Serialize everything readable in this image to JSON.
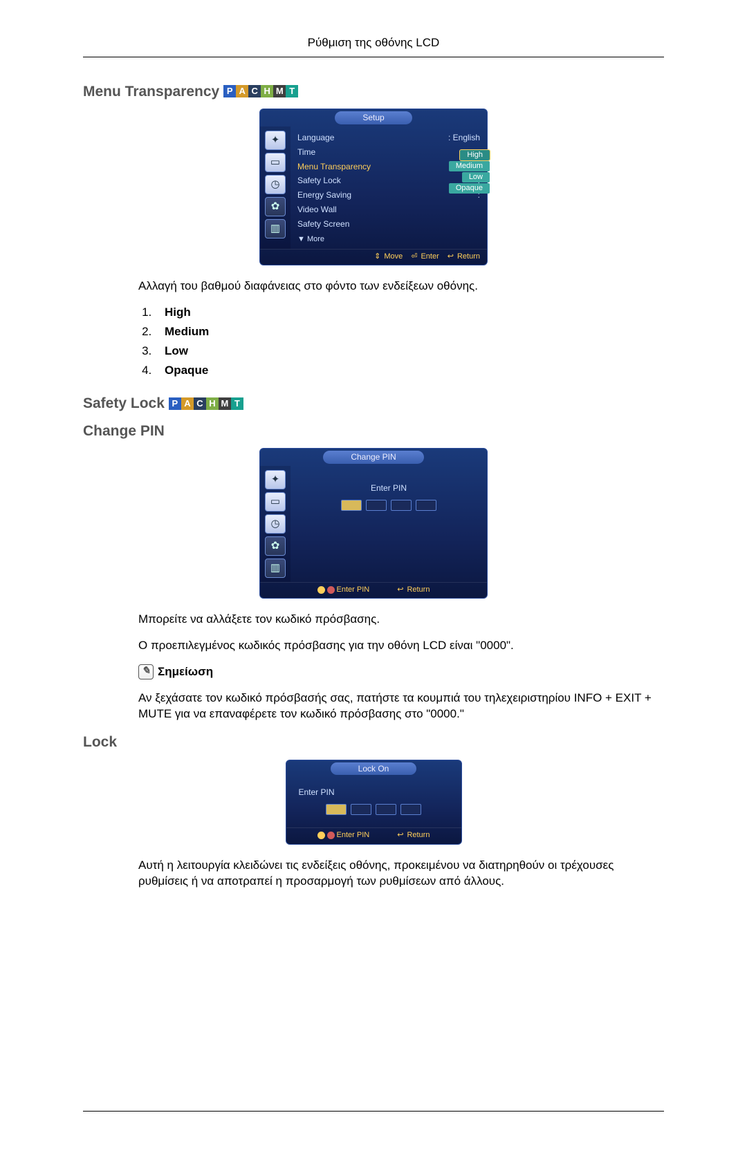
{
  "header": {
    "title": "Ρύθμιση της οθόνης LCD"
  },
  "badges": {
    "p": "P",
    "a": "A",
    "c": "C",
    "h": "H",
    "m": "M",
    "t": "T"
  },
  "section1": {
    "title": "Menu Transparency",
    "osd": {
      "title": "Setup",
      "rows": [
        {
          "k": "Language",
          "v": ": English"
        },
        {
          "k": "Time",
          "v": ""
        },
        {
          "k": "Menu Transparency",
          "v": ":",
          "selected": true
        },
        {
          "k": "Safety Lock",
          "v": ":"
        },
        {
          "k": "Energy Saving",
          "v": ":"
        },
        {
          "k": "Video Wall",
          "v": ""
        },
        {
          "k": "Safety Screen",
          "v": ""
        }
      ],
      "options": [
        "High",
        "Medium",
        "Low",
        "Opaque"
      ],
      "more": "▼ More",
      "footer": {
        "move": "Move",
        "enter": "Enter",
        "return": "Return"
      }
    },
    "desc": "Αλλαγή του βαθμού διαφάνειας στο φόντο των ενδείξεων οθόνης.",
    "list": [
      "High",
      "Medium",
      "Low",
      "Opaque"
    ]
  },
  "section2": {
    "title": "Safety Lock",
    "sub1": {
      "title": "Change PIN",
      "osd": {
        "title": "Change PIN",
        "pin_label": "Enter PIN",
        "footer": {
          "enter": "Enter PIN",
          "return": "Return"
        }
      },
      "p1": "Μπορείτε να αλλάξετε τον κωδικό πρόσβασης.",
      "p2": "Ο προεπιλεγμένος κωδικός πρόσβασης για την οθόνη LCD είναι \"0000\".",
      "note_label": "Σημείωση",
      "note_text": "Αν ξεχάσατε τον κωδικό πρόσβασής σας, πατήστε τα κουμπιά του τηλεχειριστηρίου INFO + EXIT + MUTE για να επαναφέρετε τον κωδικό πρόσβασης στο \"0000.\""
    },
    "sub2": {
      "title": "Lock",
      "osd": {
        "title": "Lock On",
        "pin_label": "Enter PIN",
        "footer": {
          "enter": "Enter PIN",
          "return": "Return"
        }
      },
      "p1": "Αυτή η λειτουργία κλειδώνει τις ενδείξεις οθόνης, προκειμένου να διατηρηθούν οι τρέχουσες ρυθμίσεις ή να αποτραπεί η προσαρμογή των ρυθμίσεων από άλλους."
    }
  }
}
